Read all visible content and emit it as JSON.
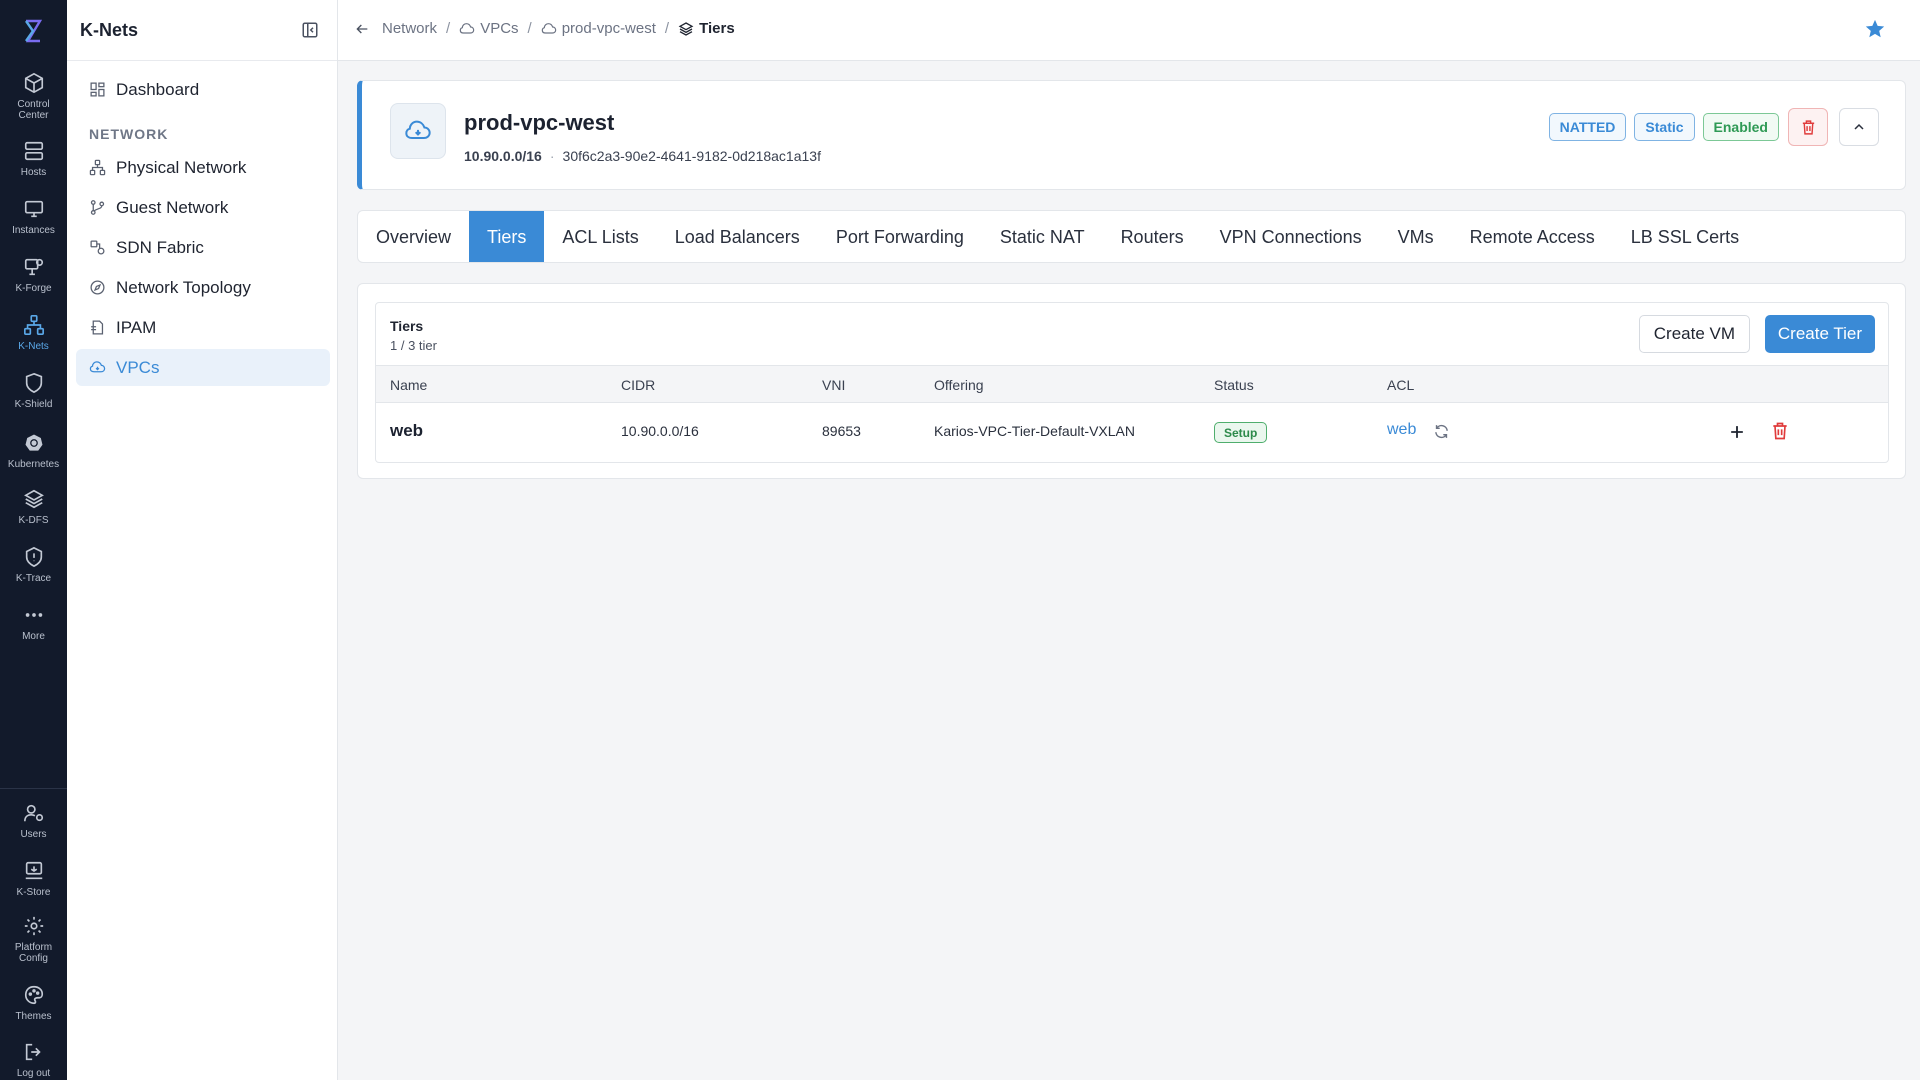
{
  "rail": {
    "items": [
      {
        "label": "Control\nCenter",
        "icon": "cube-icon"
      },
      {
        "label": "Hosts",
        "icon": "server-icon"
      },
      {
        "label": "Instances",
        "icon": "monitor-icon"
      },
      {
        "label": "K-Forge",
        "icon": "forge-icon"
      },
      {
        "label": "K-Nets",
        "icon": "network-icon"
      },
      {
        "label": "K-Shield",
        "icon": "shield-icon"
      },
      {
        "label": "Kubernetes",
        "icon": "helm-icon"
      },
      {
        "label": "K-DFS",
        "icon": "layers-icon"
      },
      {
        "label": "K-Trace",
        "icon": "trace-icon"
      },
      {
        "label": "More",
        "icon": "more-icon"
      }
    ],
    "bottom": [
      {
        "label": "Users",
        "icon": "users-icon"
      },
      {
        "label": "K-Store",
        "icon": "store-icon"
      },
      {
        "label": "Platform\nConfig",
        "icon": "gear-icon"
      },
      {
        "label": "Themes",
        "icon": "palette-icon"
      },
      {
        "label": "Log out",
        "icon": "logout-icon"
      }
    ]
  },
  "sidenav": {
    "title": "K-Nets",
    "dashboard": "Dashboard",
    "section": "NETWORK",
    "items": [
      "Physical Network",
      "Guest Network",
      "SDN Fabric",
      "Network Topology",
      "IPAM",
      "VPCs"
    ]
  },
  "breadcrumb": {
    "network": "Network",
    "vpcs": "VPCs",
    "vpc": "prod-vpc-west",
    "current": "Tiers"
  },
  "vpc": {
    "name": "prod-vpc-west",
    "cidr": "10.90.0.0/16",
    "id": "30f6c2a3-90e2-4641-9182-0d218ac1a13f",
    "badges": {
      "natted": "NATTED",
      "static": "Static",
      "enabled": "Enabled"
    }
  },
  "tabs": [
    "Overview",
    "Tiers",
    "ACL Lists",
    "Load Balancers",
    "Port Forwarding",
    "Static NAT",
    "Routers",
    "VPN Connections",
    "VMs",
    "Remote Access",
    "LB SSL Certs"
  ],
  "tiers": {
    "title": "Tiers",
    "count": "1 / 3 tier",
    "create_vm": "Create VM",
    "create_tier": "Create Tier",
    "columns": {
      "name": "Name",
      "cidr": "CIDR",
      "vni": "VNI",
      "offering": "Offering",
      "status": "Status",
      "acl": "ACL"
    },
    "rows": [
      {
        "name": "web",
        "cidr": "10.90.0.0/16",
        "vni": "89653",
        "offering": "Karios-VPC-Tier-Default-VXLAN",
        "status": "Setup",
        "acl": "web"
      }
    ]
  },
  "colors": {
    "accent": "#3a8ad6",
    "rail": "#121a2b",
    "danger": "#e03b3b",
    "success": "#2f9a55"
  }
}
